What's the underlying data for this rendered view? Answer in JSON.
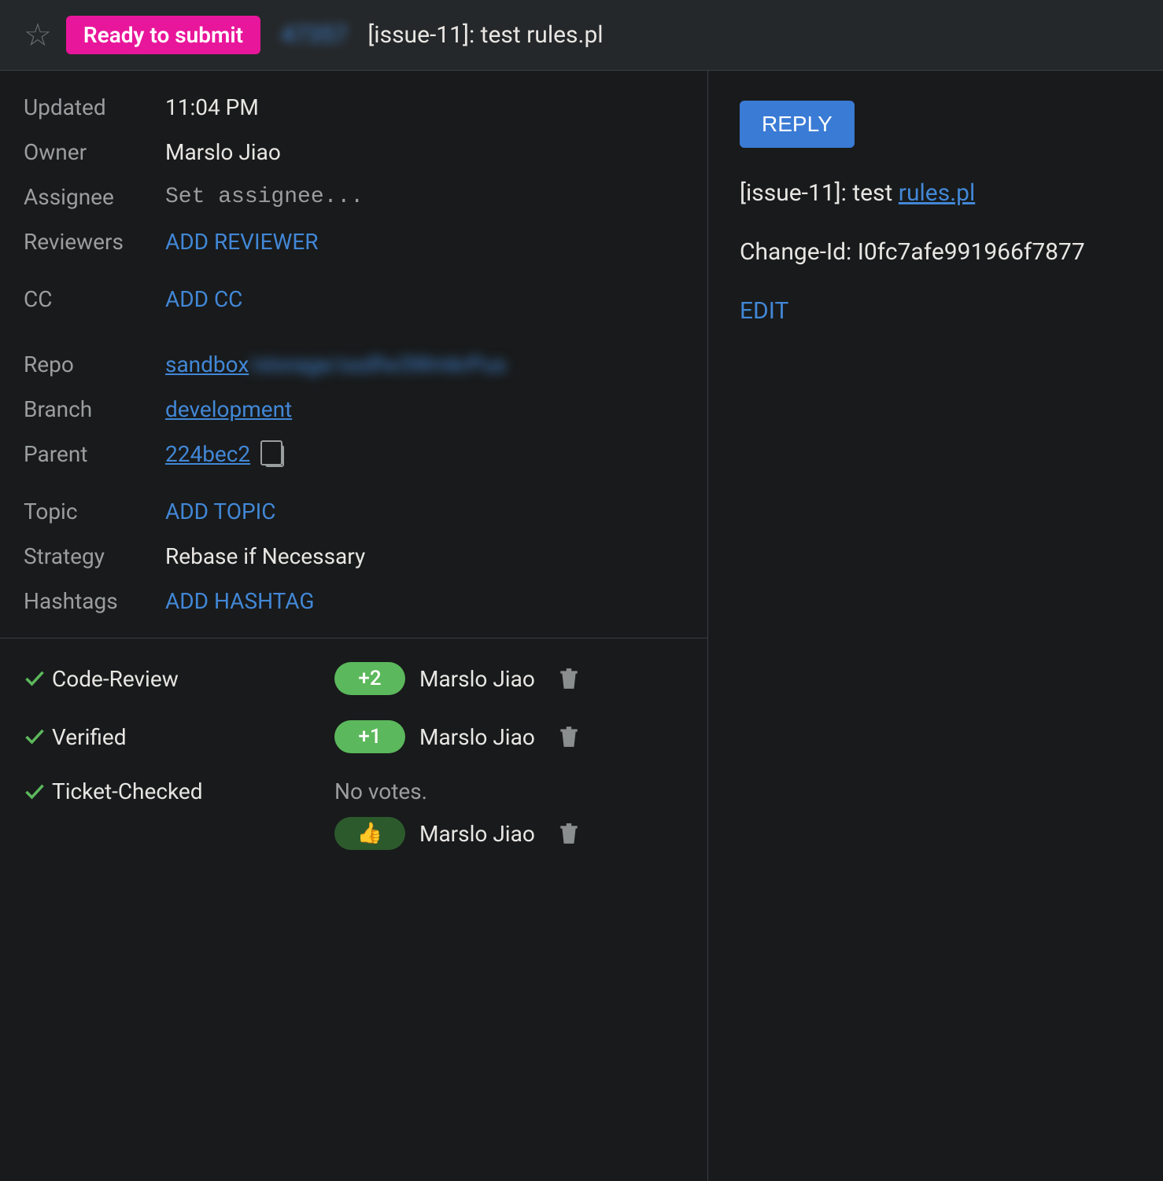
{
  "header": {
    "status_badge": "Ready to submit",
    "change_number": "47357",
    "title": "[issue-11]: test rules.pl"
  },
  "metadata": {
    "updated_label": "Updated",
    "updated_value": "11:04 PM",
    "owner_label": "Owner",
    "owner_value": "Marslo Jiao",
    "assignee_label": "Assignee",
    "assignee_placeholder": "Set assignee...",
    "reviewers_label": "Reviewers",
    "reviewers_action": "ADD REVIEWER",
    "cc_label": "CC",
    "cc_action": "ADD CC",
    "repo_label": "Repo",
    "repo_value": "sandbox",
    "repo_blurred": "/storage/ssdfw3WmkrPus",
    "branch_label": "Branch",
    "branch_value": "development",
    "parent_label": "Parent",
    "parent_value": "224bec2",
    "topic_label": "Topic",
    "topic_action": "ADD TOPIC",
    "strategy_label": "Strategy",
    "strategy_value": "Rebase if Necessary",
    "hashtags_label": "Hashtags",
    "hashtags_action": "ADD HASHTAG"
  },
  "labels": {
    "code_review": {
      "name": "Code-Review",
      "vote": "+2",
      "voter": "Marslo Jiao"
    },
    "verified": {
      "name": "Verified",
      "vote": "+1",
      "voter": "Marslo Jiao"
    },
    "ticket_checked": {
      "name": "Ticket-Checked",
      "no_votes": "No votes.",
      "thumb": "👍",
      "voter": "Marslo Jiao"
    }
  },
  "right": {
    "reply_button": "REPLY",
    "commit_prefix": "[issue-11]: test ",
    "commit_link": "rules.pl",
    "change_id_label": "Change-Id: ",
    "change_id_value": "I0fc7afe991966f7877",
    "edit_link": "EDIT"
  }
}
